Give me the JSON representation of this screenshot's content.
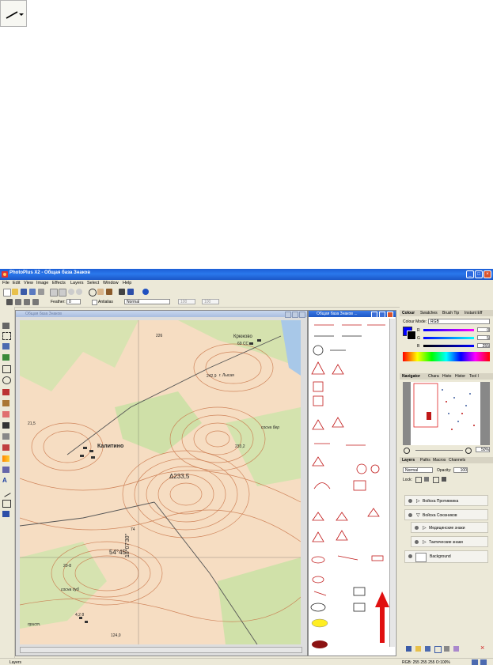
{
  "floating_tool": {
    "icon": "line-tool-icon"
  },
  "app": {
    "title": "PhotoPlus X2 - Общая база Знаков",
    "menu": [
      "File",
      "Edit",
      "View",
      "Image",
      "Effects",
      "Layers",
      "Select",
      "Window",
      "Help"
    ],
    "context": {
      "feather_label": "Feather:",
      "feather_value": "0",
      "antialias_label": "Antialias",
      "blend_mode": "Normal",
      "opacity_value": "100",
      "third_value": "100"
    },
    "doc_window": {
      "title": "Общая база Знаков"
    },
    "palette_window": {
      "title": "Общая база Знаков ..."
    },
    "map_labels": {
      "kryukovo": "Крюково",
      "kryukovo_num": "69 СС",
      "lysaya": "г. Лысая",
      "h242": "242,9",
      "kalitino": "Калитино",
      "h233a": "Δ233,5",
      "h233b": "233,2",
      "h215": "21,5",
      "lat": "54°45'",
      "lon": "18°07'30\"",
      "sosna_ber": "сосна бер",
      "h124": "124,0",
      "prist": "прист.",
      "sosna_dub": "сосна дуб",
      "h20": "20-8",
      "h28": "4,2 8",
      "h74": "74",
      "h226": "226"
    },
    "colour_panel": {
      "tabs": [
        "Colour",
        "Swatches",
        "Brush Tip",
        "Instant Eff"
      ],
      "mode_label": "Colour Mode:",
      "mode_value": "RGB",
      "r_label": "R",
      "g_label": "G",
      "b_label": "B",
      "r_value": "0",
      "g_value": "5",
      "b_value": "255",
      "primary_color": "#0000ff"
    },
    "navigator_panel": {
      "tabs": [
        "Navigator",
        "Chara",
        "Histo",
        "Histor",
        "Tool I"
      ],
      "zoom": "50%"
    },
    "layers_panel": {
      "tabs": [
        "Layers",
        "Paths",
        "Macros",
        "Channels"
      ],
      "blend": "Normal",
      "opacity_label": "Opacity:",
      "opacity_value": "100",
      "lock_label": "Lock:",
      "layers": [
        {
          "name": "Войска Противника"
        },
        {
          "name": "Войска Союзников"
        },
        {
          "name": "Медицинские знаки"
        },
        {
          "name": "Тактические знаки"
        },
        {
          "name": "Background"
        }
      ]
    },
    "status": {
      "left": "Layers",
      "right": "RGB: 255 255 255 O:100%"
    }
  }
}
